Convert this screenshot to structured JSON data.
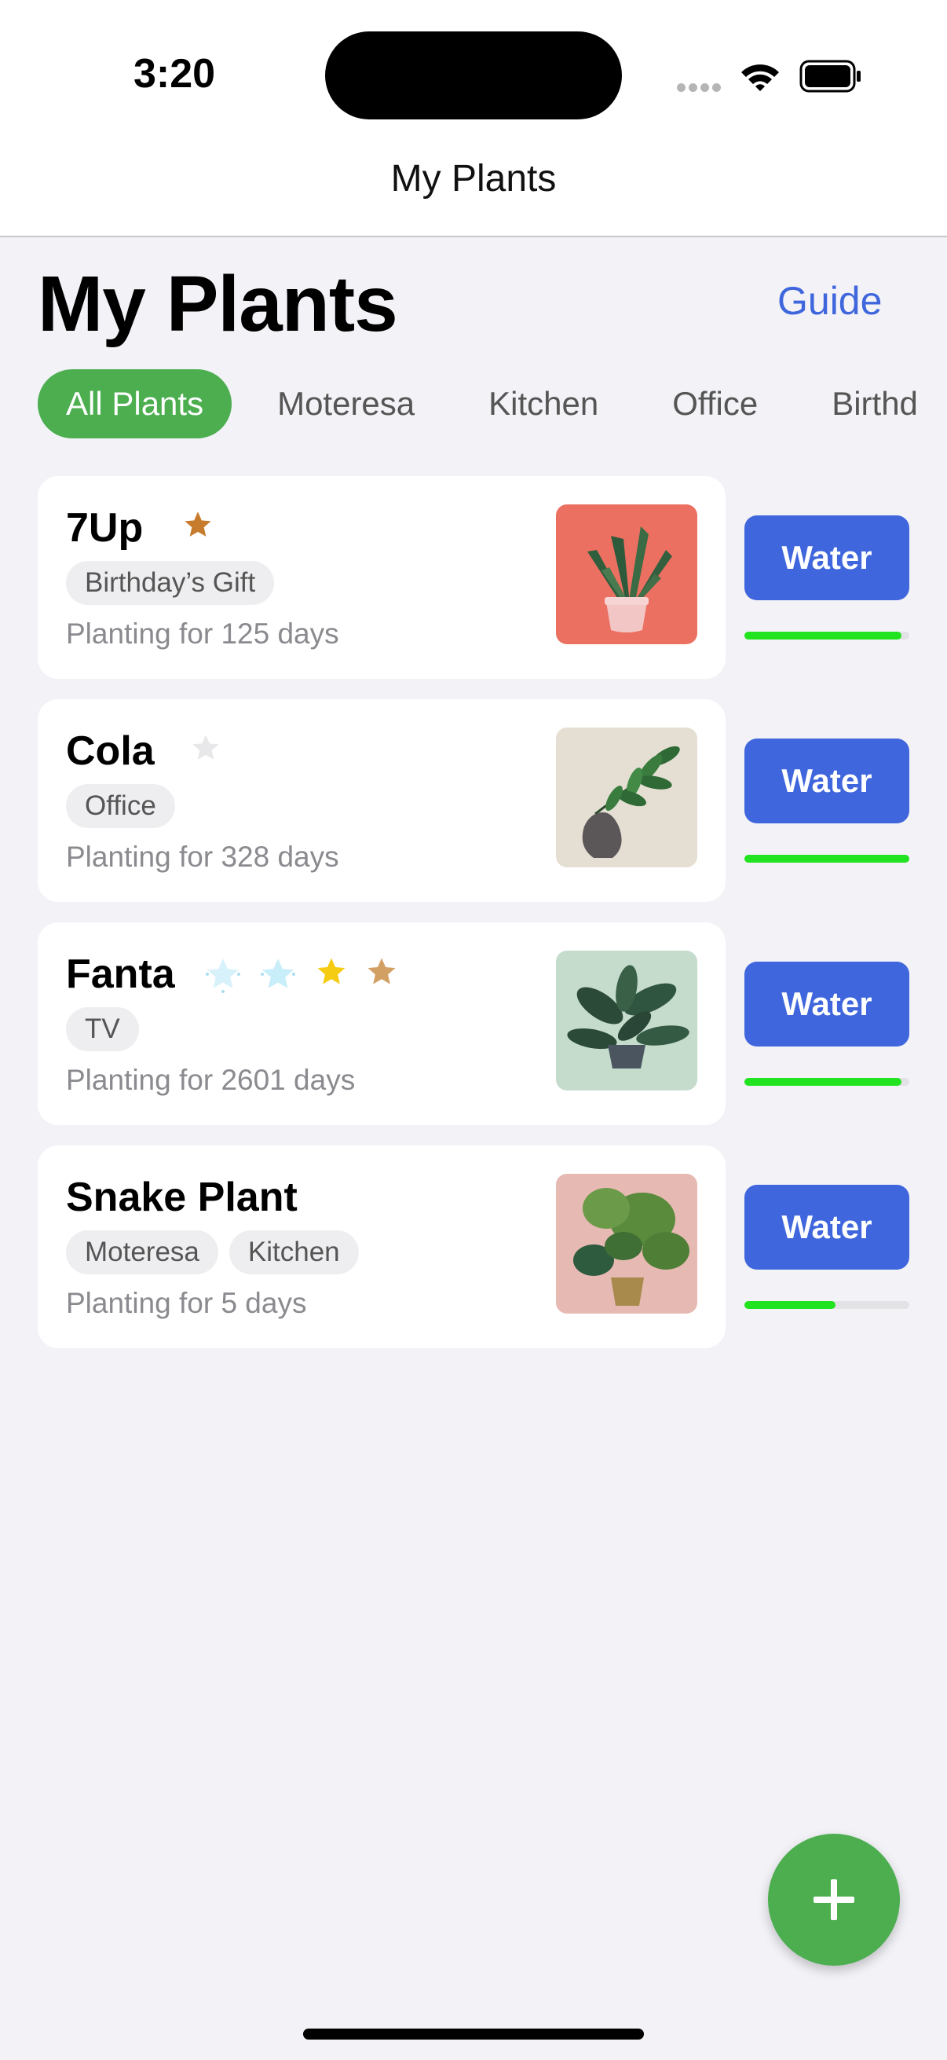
{
  "status": {
    "time": "3:20"
  },
  "nav": {
    "title": "My Plants"
  },
  "header": {
    "title": "My Plants",
    "guide_label": "Guide"
  },
  "filters": [
    "All Plants",
    "Moteresa",
    "Kitchen",
    "Office",
    "Birthd"
  ],
  "plants": [
    {
      "name": "7Up",
      "stars": [
        {
          "color": "#c77b2c",
          "icon": "star"
        }
      ],
      "tags": [
        "Birthday’s Gift"
      ],
      "days": "Planting for 125 days",
      "thumb_bg": "#ec7061",
      "water_label": "Water",
      "water_level": 0.95
    },
    {
      "name": "Cola",
      "stars": [
        {
          "color": "#e8e8ea",
          "icon": "star"
        }
      ],
      "tags": [
        "Office"
      ],
      "days": "Planting for 328 days",
      "thumb_bg": "#e5dfd3",
      "water_label": "Water",
      "water_level": 1.0
    },
    {
      "name": "Fanta",
      "stars": [
        {
          "color": "#d8f2fb",
          "icon": "sparkle-star"
        },
        {
          "color": "#c8eef9",
          "icon": "sparkle-star"
        },
        {
          "color": "#f5cc12",
          "icon": "star"
        },
        {
          "color": "#d3a064",
          "icon": "star"
        }
      ],
      "tags": [
        "TV"
      ],
      "days": "Planting for 2601 days",
      "thumb_bg": "#c5dccd",
      "water_label": "Water",
      "water_level": 0.95
    },
    {
      "name": "Snake Plant",
      "stars": [],
      "tags": [
        "Moteresa",
        "Kitchen"
      ],
      "days": "Planting for 5 days",
      "thumb_bg": "#e6b9b3",
      "water_label": "Water",
      "water_level": 0.55
    }
  ]
}
